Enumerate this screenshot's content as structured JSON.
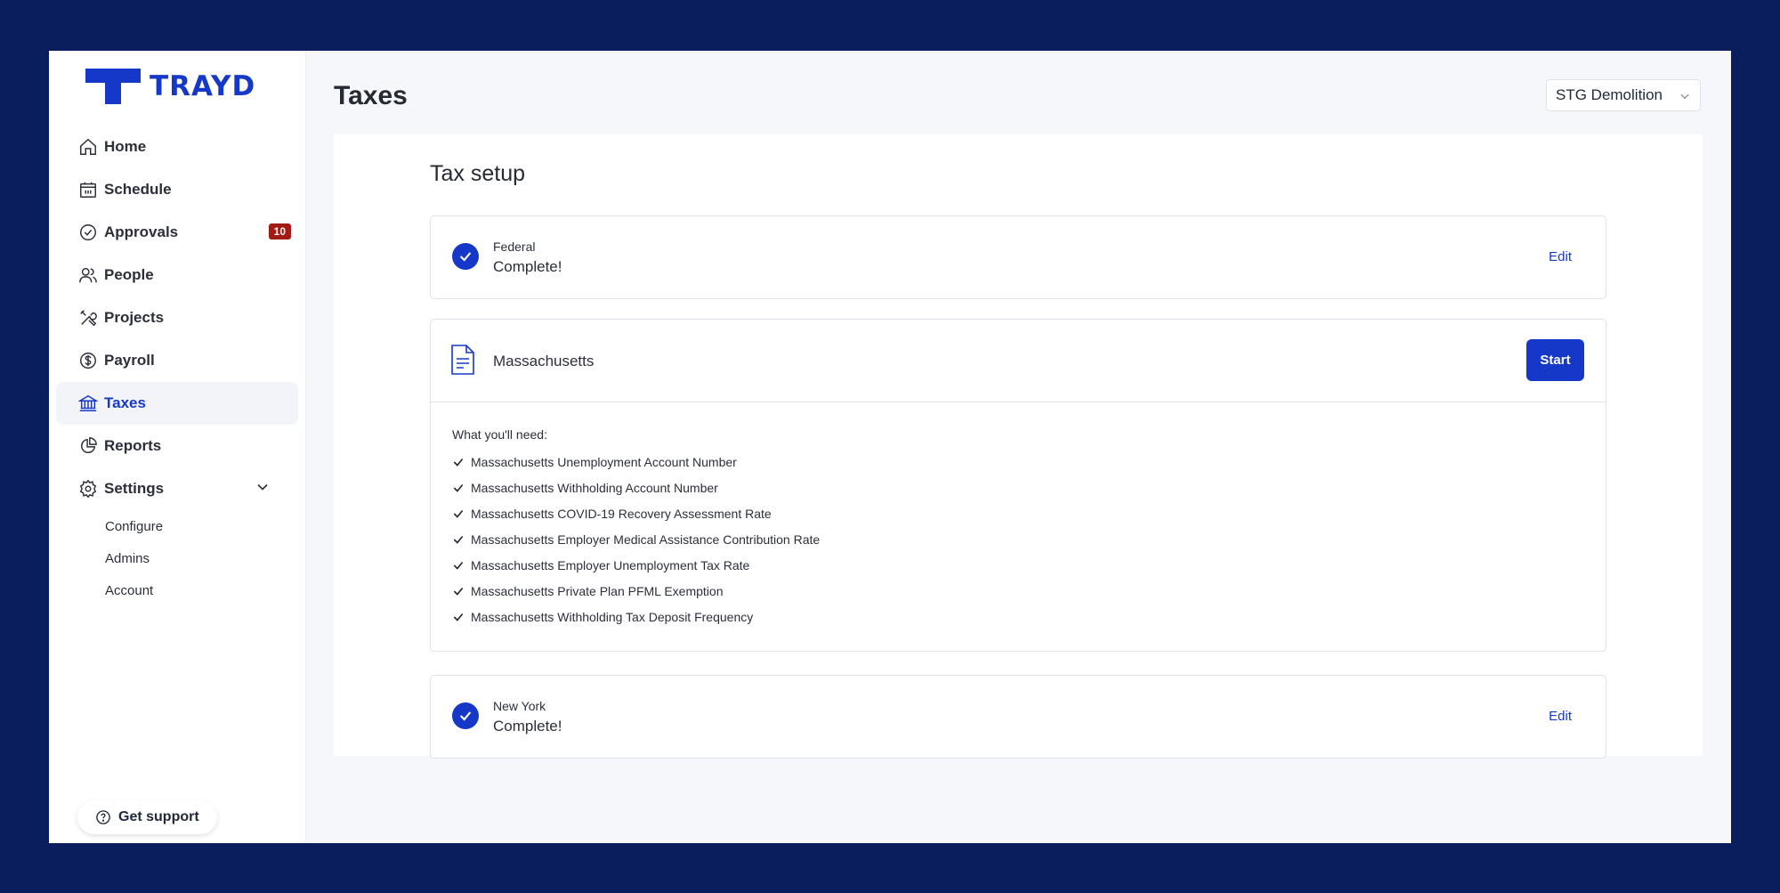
{
  "brand": {
    "name": "TRAYD",
    "color": "#1638c8"
  },
  "sidebar": {
    "items": [
      {
        "label": "Home",
        "icon": "home-icon"
      },
      {
        "label": "Schedule",
        "icon": "calendar-icon"
      },
      {
        "label": "Approvals",
        "icon": "check-circle-icon",
        "badge": "10"
      },
      {
        "label": "People",
        "icon": "people-icon"
      },
      {
        "label": "Projects",
        "icon": "tools-icon"
      },
      {
        "label": "Payroll",
        "icon": "dollar-icon"
      },
      {
        "label": "Taxes",
        "icon": "bank-icon",
        "active": true
      },
      {
        "label": "Reports",
        "icon": "pie-chart-icon"
      },
      {
        "label": "Settings",
        "icon": "gear-icon",
        "expanded": true
      }
    ],
    "settings_sub": [
      "Configure",
      "Admins",
      "Account"
    ],
    "support_label": "Get support"
  },
  "header": {
    "title": "Taxes",
    "org_select": "STG Demolition"
  },
  "tax_setup": {
    "title": "Tax setup",
    "federal": {
      "kicker": "Federal",
      "status": "Complete!",
      "action": "Edit"
    },
    "massachusetts": {
      "name": "Massachusetts",
      "action": "Start",
      "needs_title": "What you'll need:",
      "needs": [
        "Massachusetts Unemployment Account Number",
        "Massachusetts Withholding Account Number",
        "Massachusetts COVID-19 Recovery Assessment Rate",
        "Massachusetts Employer Medical Assistance Contribution Rate",
        "Massachusetts Employer Unemployment Tax Rate",
        "Massachusetts Private Plan PFML Exemption",
        "Massachusetts Withholding Tax Deposit Frequency"
      ]
    },
    "new_york": {
      "kicker": "New York",
      "status": "Complete!",
      "action": "Edit"
    }
  }
}
